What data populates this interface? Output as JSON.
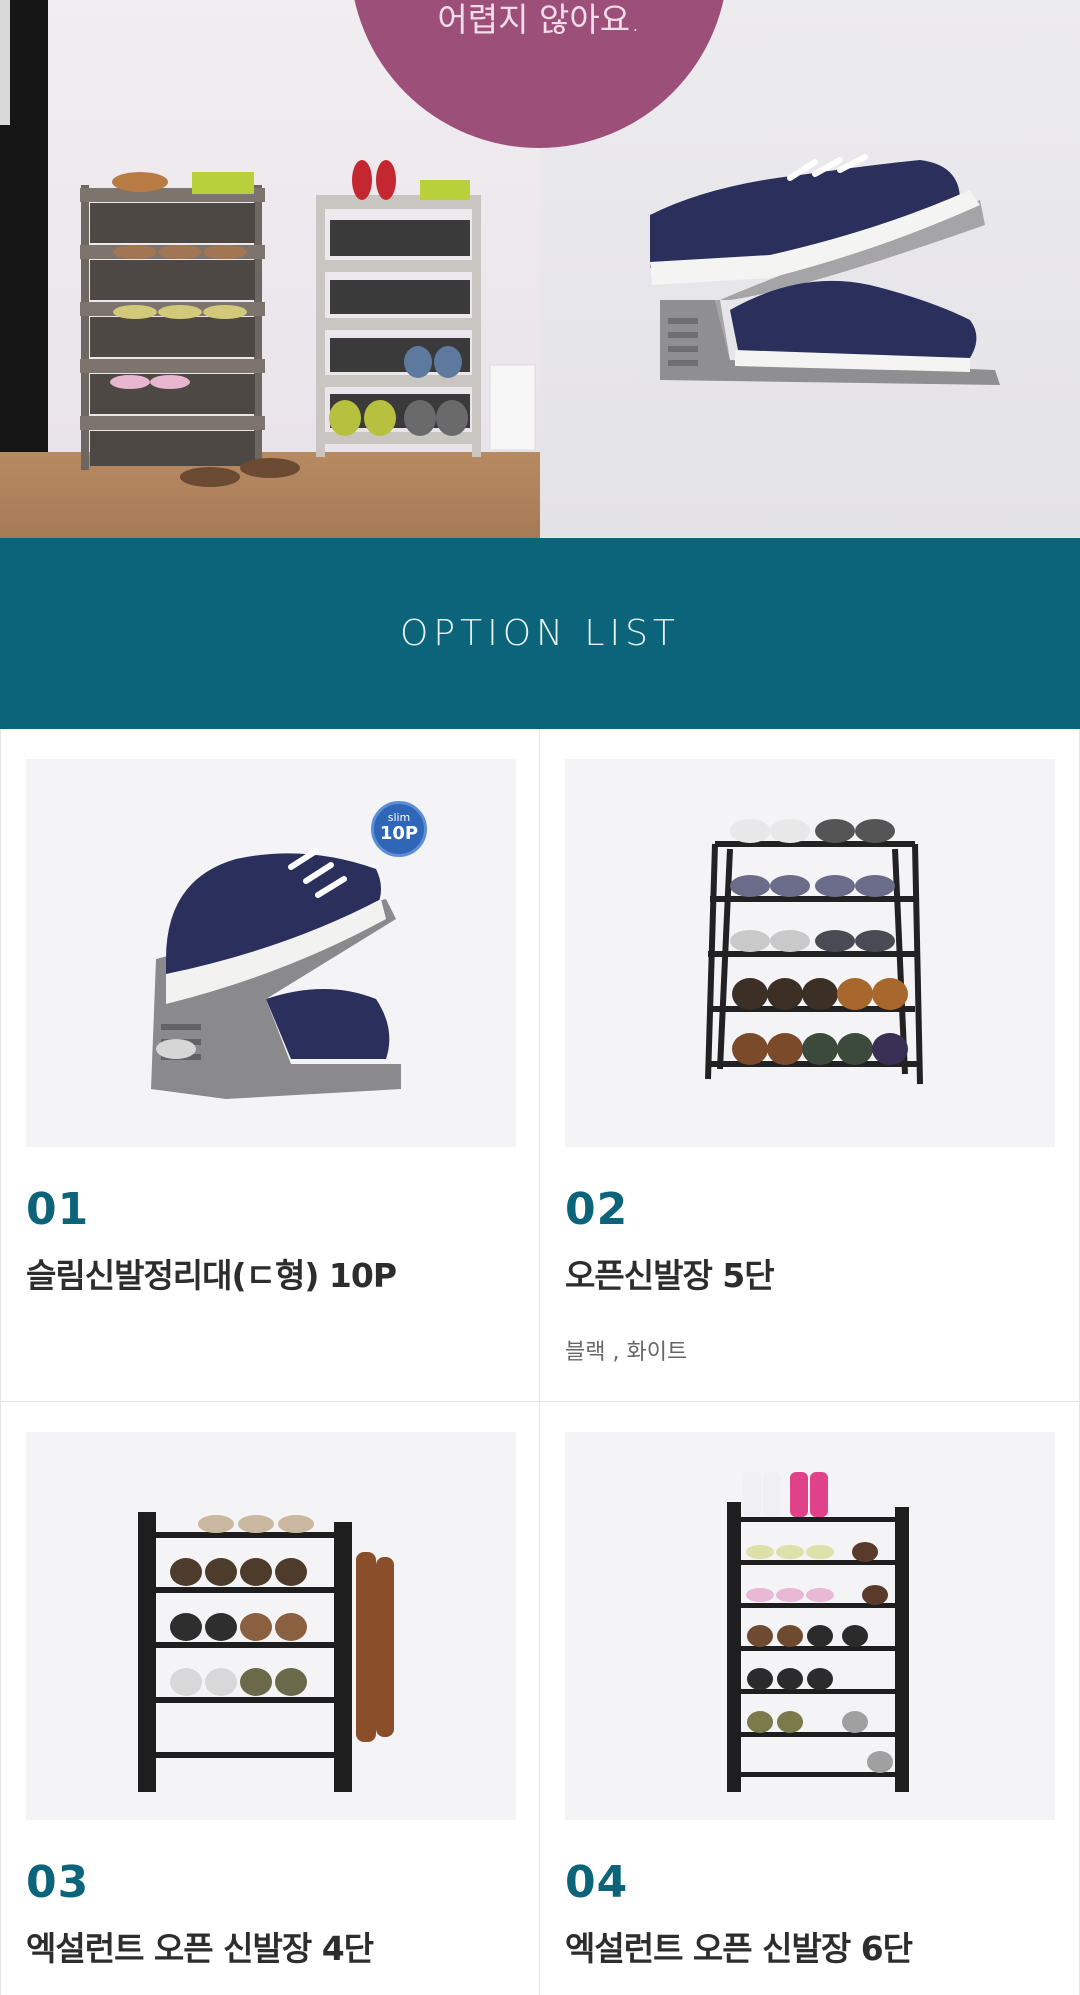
{
  "hero": {
    "caption": "어렵지 않아요."
  },
  "section": {
    "title": "OPTION LIST"
  },
  "options": [
    {
      "number": "01",
      "name": "슬림신발정리대(ㄷ형) 10P",
      "badge_top": "slim",
      "badge_bottom": "10P"
    },
    {
      "number": "02",
      "name": "오픈신발장 5단",
      "colors": "블랙 , 화이트"
    },
    {
      "number": "03",
      "name": "엑설런트 오픈 신발장 4단"
    },
    {
      "number": "04",
      "name": "엑설런트 오픈 신발장 6단"
    }
  ],
  "colors": {
    "accent": "#0b6479",
    "hero_circle": "#9c5079",
    "badge": "#2f66b8"
  }
}
